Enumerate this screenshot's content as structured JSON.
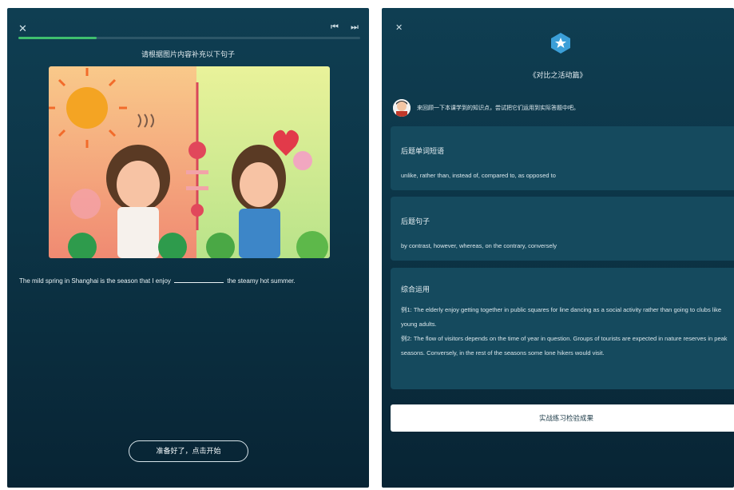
{
  "left": {
    "close_icon": "✕",
    "prev_icon": "⏮",
    "next_icon": "⏭",
    "progress": 0.23,
    "instruction": "请根据图片内容补充以下句子",
    "sentence_before": "The mild spring in Shanghai is the season that I enjoy",
    "sentence_after": "the steamy hot summer.",
    "start_button": "准备好了，点击开始"
  },
  "right": {
    "close_icon": "✕",
    "title": "《对比之活动篇》",
    "intro": "来回顾一下本课学到的知识点，尝试把它们运用到实际答题中吧。",
    "cards": {
      "vocab": {
        "title": "后题单词短语",
        "body": "unlike, rather than, instead of, compared to, as opposed to"
      },
      "sentences": {
        "title": "后题句子",
        "body": "by contrast, however, whereas, on the contrary, conversely"
      },
      "usage": {
        "title": "综合运用",
        "example1": "例1: The elderly enjoy getting together in public squares for line dancing as a social activity rather than going to clubs like young adults.",
        "example2": "例2: The flow of visitors depends on the time of year in question. Groups of tourists are expected in nature reserves in peak seasons. Conversely, in the rest of the seasons some lone hikers would visit."
      }
    },
    "practice_button": "实战练习检验成果"
  },
  "colors": {
    "panel_top": "#0f3e52",
    "panel_bottom": "#082434",
    "card": "#154a5e",
    "progress": "#3fbf6e"
  }
}
